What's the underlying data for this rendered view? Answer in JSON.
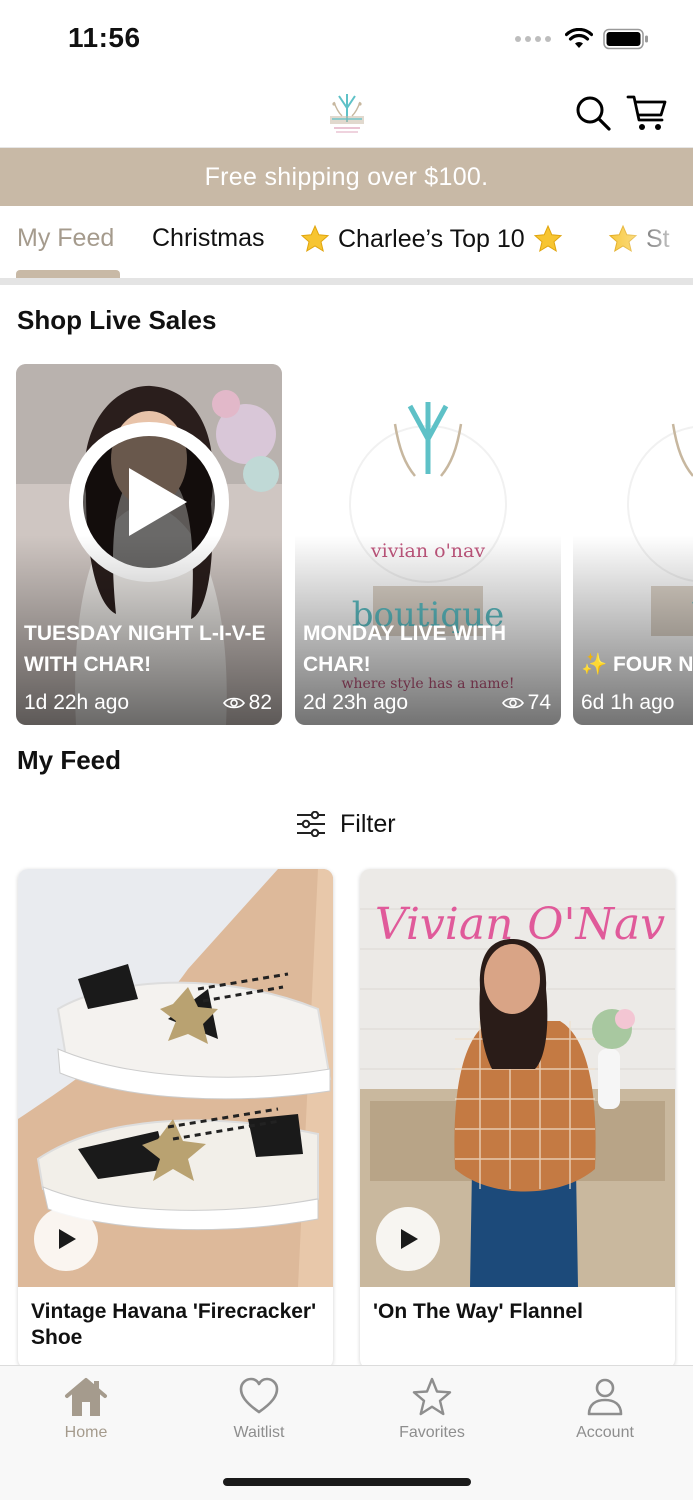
{
  "status_bar": {
    "time": "11:56"
  },
  "header": {
    "logo_icon": "vivian-onav-boutique-logo",
    "search_icon": "search-icon",
    "cart_icon": "cart-icon"
  },
  "banner": {
    "text": "Free shipping over $100."
  },
  "tabs": [
    {
      "label": "My Feed",
      "active": true
    },
    {
      "label": "Christmas",
      "active": false
    },
    {
      "label": "Charlee’s Top 10",
      "active": false
    },
    {
      "label": "St",
      "active": false
    }
  ],
  "live_sales": {
    "title": "Shop Live Sales",
    "cards": [
      {
        "title": "TUESDAY NIGHT L-I-V-E WITH CHAR!",
        "time": "1d 22h ago",
        "views": "82"
      },
      {
        "title": " MONDAY LIVE WITH CHAR!",
        "time": "2d 23h ago",
        "views": "74"
      },
      {
        "title": "✨ FOUR N OUTFITS W",
        "time": "6d 1h ago",
        "views": ""
      }
    ]
  },
  "feed": {
    "title": "My Feed",
    "filter_label": "Filter",
    "products": [
      {
        "name": "Vintage Havana 'Firecracker' Shoe"
      },
      {
        "name": "'On The Way' Flannel"
      }
    ]
  },
  "tabbar": {
    "items": [
      {
        "label": "Home",
        "icon": "home-icon",
        "active": true
      },
      {
        "label": "Waitlist",
        "icon": "heart-icon",
        "active": false
      },
      {
        "label": "Favorites",
        "icon": "star-icon",
        "active": false
      },
      {
        "label": "Account",
        "icon": "person-icon",
        "active": false
      }
    ]
  },
  "colors": {
    "accent": "#c8b9a6",
    "accent_text": "#a59b8d"
  }
}
